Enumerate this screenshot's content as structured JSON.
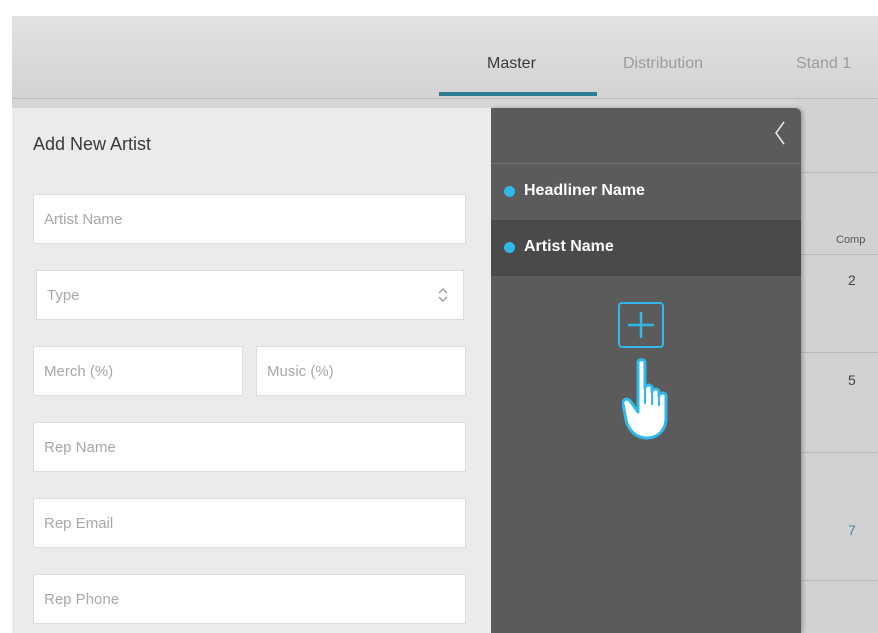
{
  "tabs": [
    {
      "label": "Master",
      "active": true
    },
    {
      "label": "Distribution",
      "active": false
    },
    {
      "label": "Stand 1",
      "active": false
    }
  ],
  "background_table": {
    "column_header": "Comp",
    "values": [
      "2",
      "5",
      "7"
    ]
  },
  "form": {
    "title": "Add New Artist",
    "artist_name_placeholder": "Artist Name",
    "type_placeholder": "Type",
    "merch_placeholder": "Merch (%)",
    "music_placeholder": "Music (%)",
    "rep_name_placeholder": "Rep Name",
    "rep_email_placeholder": "Rep Email",
    "rep_phone_placeholder": "Rep Phone"
  },
  "drawer": {
    "artists": [
      {
        "label": "Headliner Name",
        "selected": false
      },
      {
        "label": "Artist Name",
        "selected": true
      }
    ],
    "icons": {
      "collapse": "chevron-left-icon",
      "add": "plus-icon",
      "pointer": "hand-pointer-icon"
    }
  },
  "colors": {
    "accent": "#31b8e8",
    "tab_underline": "#2b7f93",
    "drawer_bg": "#5b5b5b",
    "drawer_selected": "#4a4a4a",
    "form_bg": "#ebebeb"
  }
}
